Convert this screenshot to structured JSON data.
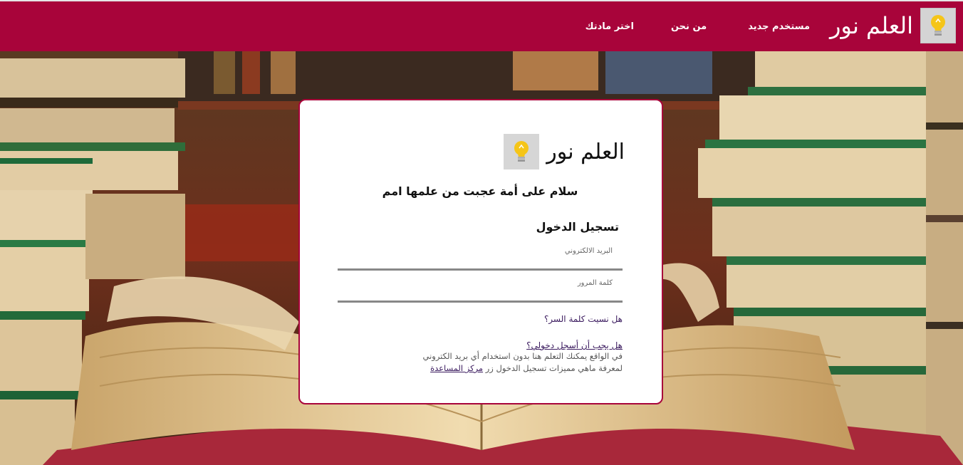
{
  "navbar": {
    "brand": "العلم نور",
    "links": [
      "مستخدم جديد",
      "من نحن",
      "اختر مادتك"
    ],
    "color": "#a8043a"
  },
  "card": {
    "brand": "العلم نور",
    "tagline": "سلام على أمة عجبت من علمها امم",
    "login_title": "تسجيل الدخول",
    "email_label": "البريد الالكتروني",
    "password_label": "كلمة المرور",
    "forgot_link": "هل نسيت كلمة السر؟",
    "must_login_link": "هل يجب أن أسجل دخولي؟",
    "info_line1": "في الواقع يمكنك التعلم هنا بدون استخدام أي بريد الكتروني",
    "info_line2": "لمعرفة ماهي مميزات تسجيل الدخول زر ",
    "help_center_link": "مركز المساعدة"
  },
  "icons": {
    "logo": "lightbulb-icon"
  }
}
